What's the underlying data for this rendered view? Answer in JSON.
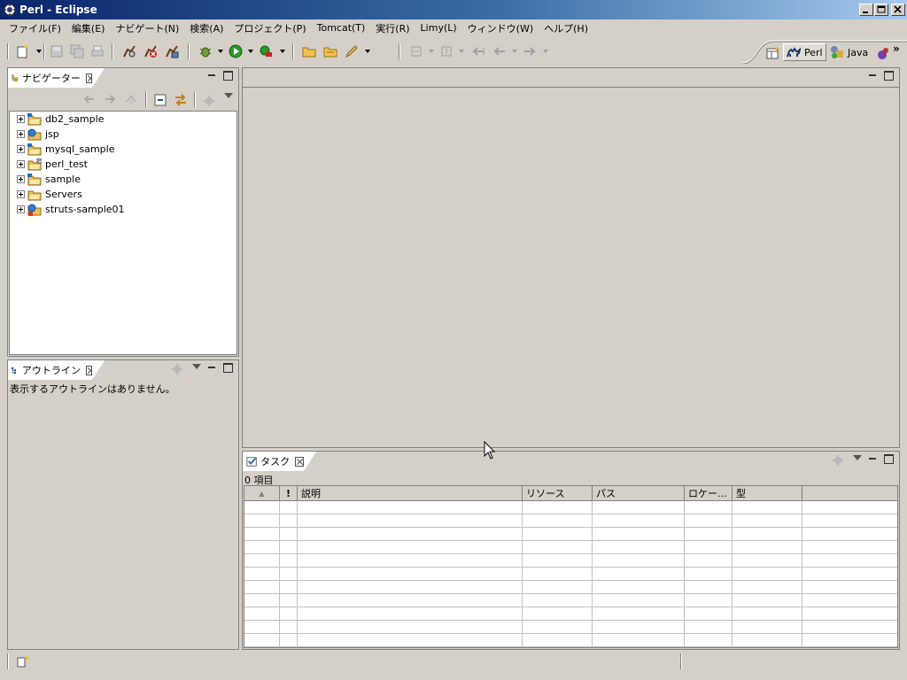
{
  "window": {
    "title": "Perl - Eclipse",
    "controls": {
      "minimize": "_",
      "maximize": "□",
      "close": "✕"
    }
  },
  "menubar": {
    "items": [
      {
        "label": "ファイル(F)"
      },
      {
        "label": "編集(E)"
      },
      {
        "label": "ナビゲート(N)"
      },
      {
        "label": "検索(A)"
      },
      {
        "label": "プロジェクト(P)"
      },
      {
        "label": "Tomcat(T)"
      },
      {
        "label": "実行(R)"
      },
      {
        "label": "Limy(L)"
      },
      {
        "label": "ウィンドウ(W)"
      },
      {
        "label": "ヘルプ(H)"
      }
    ]
  },
  "perspectives": {
    "open_label": "",
    "perl_label": "Perl",
    "java_label": "Java",
    "more_label": "»"
  },
  "navigator": {
    "tab_label": "ナビゲーター",
    "items": [
      {
        "label": "db2_sample"
      },
      {
        "label": "jsp"
      },
      {
        "label": "mysql_sample"
      },
      {
        "label": "perl_test"
      },
      {
        "label": "sample"
      },
      {
        "label": "Servers"
      },
      {
        "label": "struts-sample01"
      }
    ]
  },
  "outline": {
    "tab_label": "アウトライン",
    "message": "表示するアウトラインはありません。"
  },
  "tasks": {
    "tab_label": "タスク",
    "count_label": "0 項目",
    "columns": [
      {
        "label": "▲"
      },
      {
        "label": "!"
      },
      {
        "label": "説明"
      },
      {
        "label": "リソース"
      },
      {
        "label": "パス"
      },
      {
        "label": "ロケー..."
      },
      {
        "label": "型"
      },
      {
        "label": ""
      }
    ]
  },
  "colors": {
    "title_gradient_start": "#0a246a",
    "title_gradient_end": "#a6caf0",
    "chrome": "#d4d0c8",
    "folder": "#e8c05a"
  }
}
